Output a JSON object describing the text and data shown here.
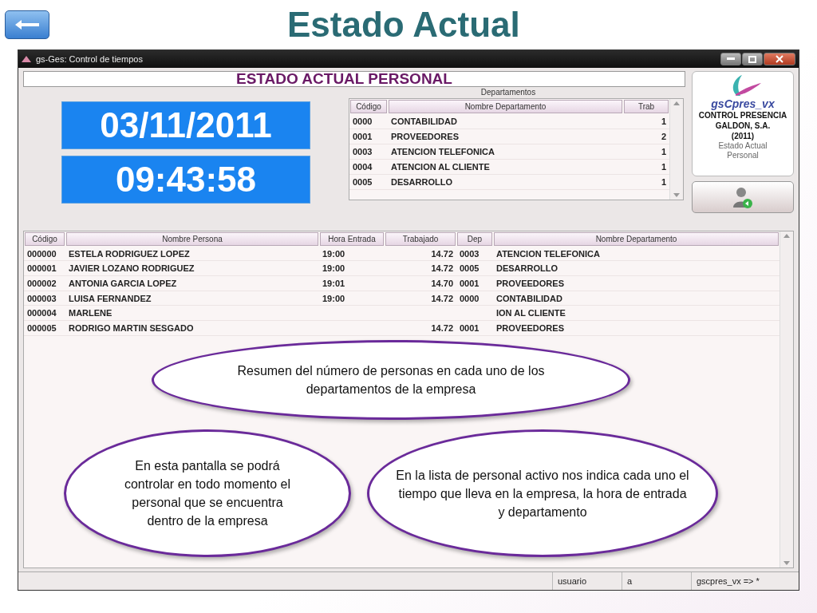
{
  "slide": {
    "title": "Estado Actual"
  },
  "window": {
    "title": "gs-Ges: Control de tiempos",
    "heading": "ESTADO ACTUAL PERSONAL",
    "date": "03/11/2011",
    "time": "09:43:58"
  },
  "departments": {
    "caption": "Departamentos",
    "columns": [
      "Código",
      "Nombre Departamento",
      "Trab"
    ],
    "rows": [
      {
        "code": "0000",
        "name": "CONTABILIDAD",
        "count": "1"
      },
      {
        "code": "0001",
        "name": "PROVEEDORES",
        "count": "2"
      },
      {
        "code": "0003",
        "name": "ATENCION TELEFONICA",
        "count": "1"
      },
      {
        "code": "0004",
        "name": "ATENCION AL CLIENTE",
        "count": "1"
      },
      {
        "code": "0005",
        "name": "DESARROLLO",
        "count": "1"
      }
    ]
  },
  "brand": {
    "logo_text": "gsCpres_vx",
    "lines": [
      "CONTROL PRESENCIA",
      "GALDON, S.A.",
      "(2011)"
    ],
    "caption": [
      "Estado Actual",
      "Personal"
    ]
  },
  "people": {
    "columns": [
      "Código",
      "Nombre Persona",
      "Hora Entrada",
      "Trabajado",
      "Dep",
      "Nombre Departamento"
    ],
    "rows": [
      {
        "code": "000000",
        "name": "ESTELA RODRIGUEZ LOPEZ",
        "entry": "19:00",
        "worked": "14.72",
        "dep": "0003",
        "dep_name": "ATENCION TELEFONICA"
      },
      {
        "code": "000001",
        "name": "JAVIER LOZANO RODRIGUEZ",
        "entry": "19:00",
        "worked": "14.72",
        "dep": "0005",
        "dep_name": "DESARROLLO"
      },
      {
        "code": "000002",
        "name": "ANTONIA GARCIA LOPEZ",
        "entry": "19:01",
        "worked": "14.70",
        "dep": "0001",
        "dep_name": "PROVEEDORES"
      },
      {
        "code": "000003",
        "name": "LUISA FERNANDEZ",
        "entry": "19:00",
        "worked": "14.72",
        "dep": "0000",
        "dep_name": "CONTABILIDAD"
      },
      {
        "code": "000004",
        "name": "MARLENE",
        "dep_name": "ION AL CLIENTE"
      },
      {
        "code": "000005",
        "name": "RODRIGO MARTIN SESGADO",
        "worked": "14.72",
        "dep": "0001",
        "dep_name": "PROVEEDORES"
      }
    ]
  },
  "callouts": [
    {
      "text": "Resumen del número de personas en cada uno de los departamentos de la empresa"
    },
    {
      "text": "En esta pantalla se podrá controlar en todo momento el personal que se encuentra dentro de la empresa"
    },
    {
      "text": "En la lista de personal activo nos indica cada uno el tiempo que lleva en la empresa, la hora de entrada y departamento"
    }
  ],
  "status_bar": [
    "usuario",
    "a",
    "gscpres_vx => *"
  ]
}
